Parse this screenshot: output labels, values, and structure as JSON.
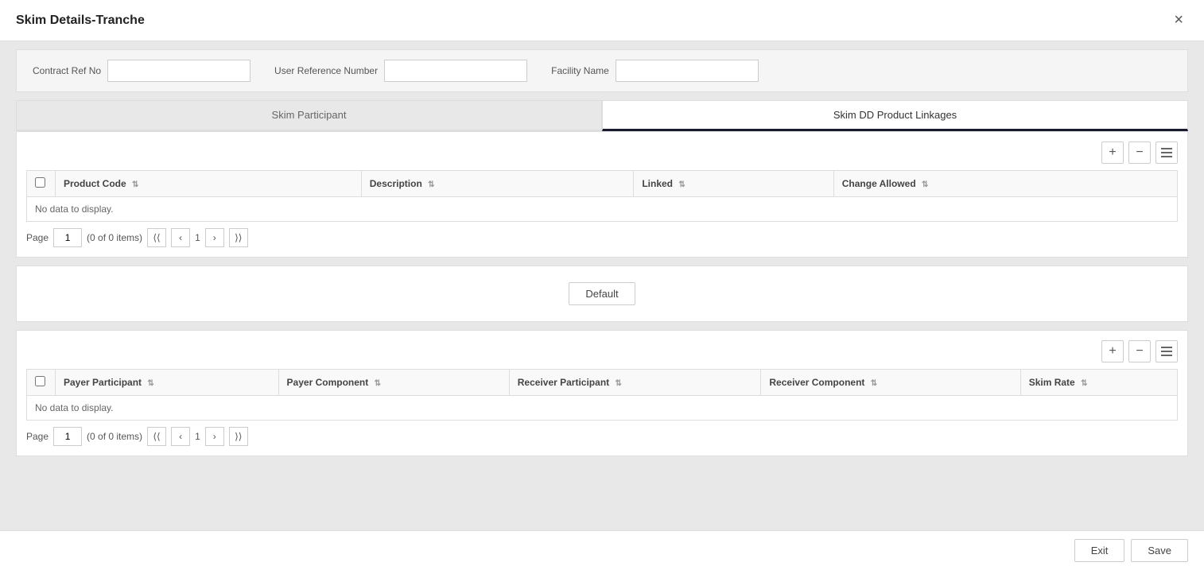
{
  "modal": {
    "title": "Skim Details-Tranche",
    "close_label": "×"
  },
  "top_form": {
    "contract_ref_label": "Contract Ref No",
    "user_ref_label": "User Reference Number",
    "facility_name_label": "Facility Name",
    "contract_ref_value": "",
    "user_ref_value": "",
    "facility_name_value": ""
  },
  "tabs": [
    {
      "label": "Skim Participant",
      "active": false
    },
    {
      "label": "Skim DD Product Linkages",
      "active": true
    }
  ],
  "table1": {
    "toolbar": {
      "add_label": "+",
      "remove_label": "−",
      "list_label": "☰"
    },
    "columns": [
      {
        "label": "Product Code",
        "sortable": true
      },
      {
        "label": "Description",
        "sortable": true
      },
      {
        "label": "Linked",
        "sortable": true
      },
      {
        "label": "Change Allowed",
        "sortable": true
      }
    ],
    "no_data": "No data to display.",
    "pagination": {
      "page_label": "Page",
      "page_value": "1",
      "items_info": "(0 of 0 items)"
    }
  },
  "default_section": {
    "button_label": "Default"
  },
  "table2": {
    "toolbar": {
      "add_label": "+",
      "remove_label": "−",
      "list_label": "☰"
    },
    "columns": [
      {
        "label": "Payer Participant",
        "sortable": true
      },
      {
        "label": "Payer Component",
        "sortable": true
      },
      {
        "label": "Receiver Participant",
        "sortable": true
      },
      {
        "label": "Receiver Component",
        "sortable": true
      },
      {
        "label": "Skim Rate",
        "sortable": true
      }
    ],
    "no_data": "No data to display.",
    "pagination": {
      "page_label": "Page",
      "page_value": "1",
      "items_info": "(0 of 0 items)"
    }
  },
  "footer": {
    "exit_label": "Exit",
    "save_label": "Save"
  }
}
